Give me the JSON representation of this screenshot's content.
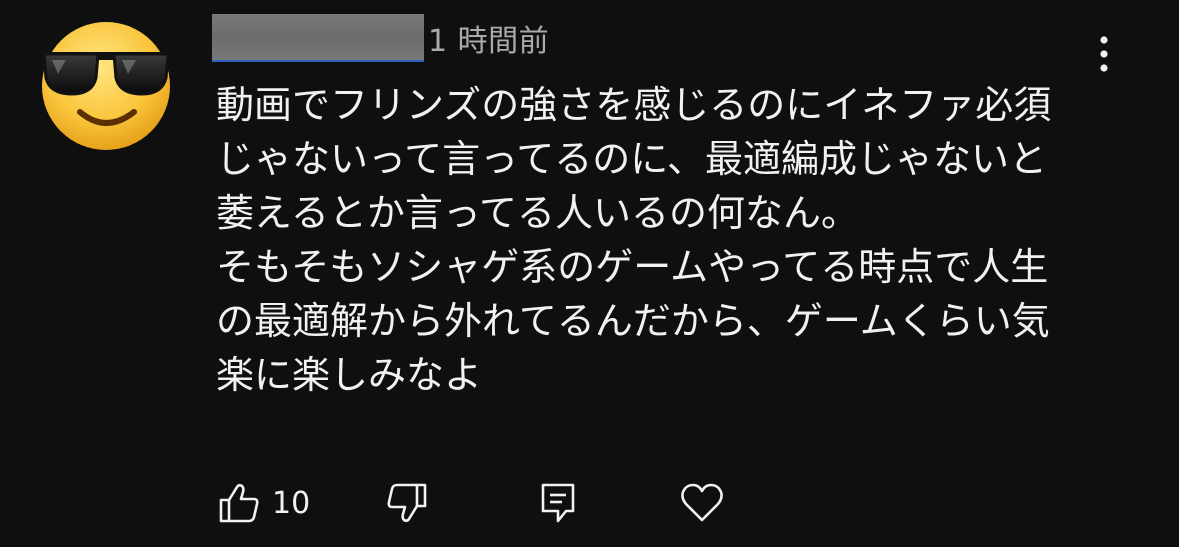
{
  "comment": {
    "timestamp": "1 時間前",
    "lines": [
      "動画でフリンズの強さを感じるのにイネファ必須",
      "じゃないって言ってるのに、最適編成じゃないと",
      "萎えるとか言ってる人いるの何なん。",
      "そもそもソシャゲ系のゲームやってる時点で人生",
      "の最適解から外れてるんだから、ゲームくらい気",
      "楽に楽しみなよ"
    ]
  },
  "actions": {
    "like_count": "10"
  },
  "icons": {
    "avatar": "smiling-face-with-sunglasses-emoji",
    "menu": "vertical-ellipsis-icon",
    "like": "thumbs-up-icon",
    "dislike": "thumbs-down-icon",
    "reply": "comment-reply-icon",
    "heart": "heart-icon"
  },
  "colors": {
    "background": "#0f0f0f",
    "text": "#f1f1f1",
    "secondary_text": "#aaaaaa"
  }
}
